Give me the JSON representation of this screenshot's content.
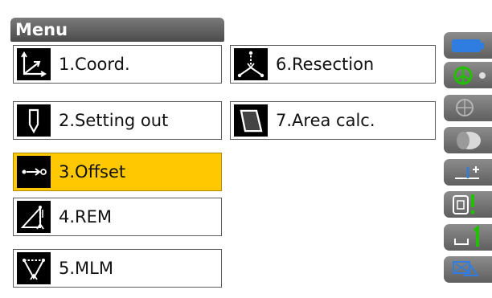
{
  "menu": {
    "title": "Menu",
    "items": [
      {
        "label": "1.Coord.",
        "icon": "coordinate-axes-icon",
        "selected": false
      },
      {
        "label": "2.Setting out",
        "icon": "plumb-bob-icon",
        "selected": false
      },
      {
        "label": "3.Offset",
        "icon": "offset-arrow-icon",
        "selected": true
      },
      {
        "label": "4.REM",
        "icon": "rem-triangle-icon",
        "selected": false
      },
      {
        "label": "5.MLM",
        "icon": "mlm-triangle-icon",
        "selected": false
      },
      {
        "label": "6.Resection",
        "icon": "resection-icon",
        "selected": false
      },
      {
        "label": "7.Area calc.",
        "icon": "area-polygon-icon",
        "selected": false
      }
    ]
  },
  "status_icons": [
    {
      "name": "battery-icon"
    },
    {
      "name": "target-prism-icon"
    },
    {
      "name": "tilt-level-icon"
    },
    {
      "name": "laser-pointer-icon"
    },
    {
      "name": "input-mode-icon"
    },
    {
      "name": "memory-card-icon"
    },
    {
      "name": "face-indicator-icon"
    },
    {
      "name": "bluetooth-communication-icon"
    }
  ],
  "colors": {
    "selected": "#ffc800",
    "title_bar": "#5a5a5a",
    "accent_blue": "#2f7de1",
    "accent_green": "#22c000"
  }
}
